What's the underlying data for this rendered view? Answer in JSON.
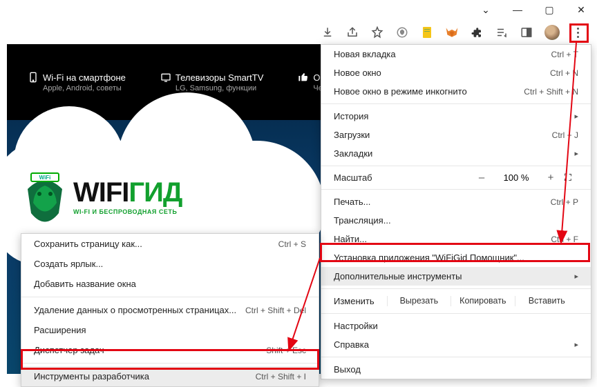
{
  "toolbar_icons": {
    "download": "download-icon",
    "share": "share-icon",
    "star": "star-icon",
    "shield": "shield-icon",
    "note": "note-icon",
    "fox": "fox-icon",
    "puzzle": "puzzle-icon",
    "music": "music-icon",
    "panel": "panel-icon",
    "avatar": "avatar",
    "kebab": "menu-button"
  },
  "nav": [
    {
      "icon": "phone-icon",
      "title": "Wi-Fi на смартфоне",
      "sub": "Apple, Android, советы"
    },
    {
      "icon": "tv-icon",
      "title": "Телевизоры SmartTV",
      "sub": "LG, Samsung, функции"
    },
    {
      "icon": "thumb-icon",
      "title": "Обзор",
      "sub": "Честный го"
    }
  ],
  "logo": {
    "wifi": "WIFI",
    "gid": "ГИД",
    "tag": "WI-FI И БЕСПРОВОДНАЯ СЕТЬ"
  },
  "menu": {
    "new_tab": {
      "label": "Новая вкладка",
      "shortcut": "Ctrl + T"
    },
    "new_window": {
      "label": "Новое окно",
      "shortcut": "Ctrl + N"
    },
    "incognito": {
      "label": "Новое окно в режиме инкогнито",
      "shortcut": "Ctrl + Shift + N"
    },
    "history": {
      "label": "История"
    },
    "downloads": {
      "label": "Загрузки",
      "shortcut": "Ctrl + J"
    },
    "bookmarks": {
      "label": "Закладки"
    },
    "zoom_label": "Масштаб",
    "zoom_minus": "–",
    "zoom_pct": "100 %",
    "zoom_plus": "+",
    "zoom_full": "⛶",
    "print": {
      "label": "Печать...",
      "shortcut": "Ctrl + P"
    },
    "cast": {
      "label": "Трансляция..."
    },
    "find": {
      "label": "Найти...",
      "shortcut": "Ctrl + F"
    },
    "install": {
      "label": "Установка приложения \"WiFiGid Помощник\"..."
    },
    "more_tools": {
      "label": "Дополнительные инструменты"
    },
    "edit_label": "Изменить",
    "edit_cut": "Вырезать",
    "edit_copy": "Копировать",
    "edit_paste": "Вставить",
    "settings": {
      "label": "Настройки"
    },
    "help": {
      "label": "Справка"
    },
    "exit": {
      "label": "Выход"
    }
  },
  "submenu": {
    "save_page": {
      "label": "Сохранить страницу как...",
      "shortcut": "Ctrl + S"
    },
    "shortcut": {
      "label": "Создать ярлык..."
    },
    "name_window": {
      "label": "Добавить название окна"
    },
    "clear_data": {
      "label": "Удаление данных о просмотренных страницах...",
      "shortcut": "Ctrl + Shift + Del"
    },
    "extensions": {
      "label": "Расширения"
    },
    "task_mgr": {
      "label": "Диспетчер задач",
      "shortcut": "Shift + Esc"
    },
    "dev_tools": {
      "label": "Инструменты разработчика",
      "shortcut": "Ctrl + Shift + I"
    }
  }
}
